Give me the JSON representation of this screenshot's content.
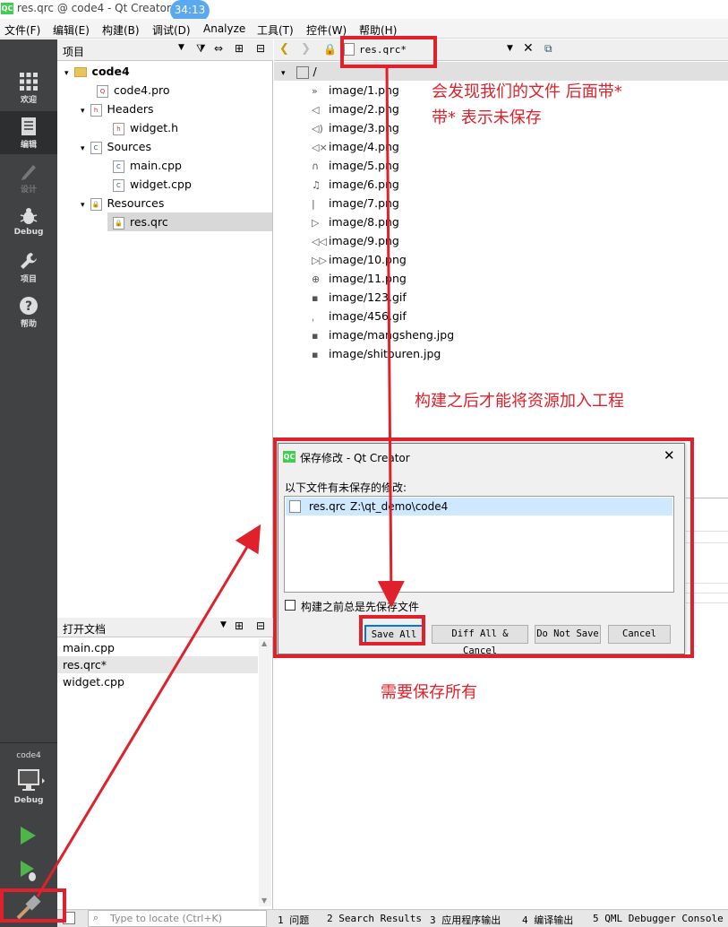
{
  "window": {
    "title": "res.qrc @ code4 - Qt Creator",
    "timer": "34:13"
  },
  "menu": [
    "文件(F)",
    "编辑(E)",
    "构建(B)",
    "调试(D)",
    "Analyze",
    "工具(T)",
    "控件(W)",
    "帮助(H)"
  ],
  "modes": [
    {
      "label": "欢迎",
      "icon": "grid-icon"
    },
    {
      "label": "编辑",
      "icon": "edit-icon"
    },
    {
      "label": "设计",
      "icon": "pen-icon"
    },
    {
      "label": "Debug",
      "icon": "bug-icon"
    },
    {
      "label": "项目",
      "icon": "wrench-icon"
    },
    {
      "label": "帮助",
      "icon": "help-icon"
    }
  ],
  "kit": {
    "project": "code4",
    "mode": "Debug"
  },
  "project_panel": {
    "title": "项目",
    "tree": [
      {
        "label": "code4",
        "level": 0,
        "bold": true
      },
      {
        "label": "code4.pro",
        "level": 1
      },
      {
        "label": "Headers",
        "level": 1
      },
      {
        "label": "widget.h",
        "level": 2
      },
      {
        "label": "Sources",
        "level": 1
      },
      {
        "label": "main.cpp",
        "level": 2
      },
      {
        "label": "widget.cpp",
        "level": 2
      },
      {
        "label": "Resources",
        "level": 1
      },
      {
        "label": "res.qrc",
        "level": 2,
        "selected": true
      }
    ]
  },
  "open_docs": {
    "title": "打开文档",
    "items": [
      "main.cpp",
      "res.qrc*",
      "widget.cpp"
    ]
  },
  "editor": {
    "tab_label": "res.qrc*",
    "prefix": "/",
    "files": [
      "image/1.png",
      "image/2.png",
      "image/3.png",
      "image/4.png",
      "image/5.png",
      "image/6.png",
      "image/7.png",
      "image/8.png",
      "image/9.png",
      "image/10.png",
      "image/11.png",
      "image/123.gif",
      "image/456.gif",
      "image/mangsheng.jpg",
      "image/shitouren.jpg"
    ]
  },
  "dialog": {
    "title": "保存修改 - Qt Creator",
    "prompt": "以下文件有未保存的修改:",
    "file_name": "res.qrc",
    "file_path": "Z:\\qt_demo\\code4",
    "checkbox_label": "构建之前总是先保存文件",
    "buttons": [
      "Save All",
      "Diff All & Cancel",
      "Do Not Save",
      "Cancel"
    ]
  },
  "statusbar": {
    "locate_placeholder": "Type to locate (Ctrl+K)",
    "tabs": [
      "1 问题",
      "2 Search Results",
      "3 应用程序输出",
      "4 编译输出",
      "5 QML Debugger Console"
    ]
  },
  "annotations": [
    "会发现我们的文件 后面带*",
    "带*   表示未保存",
    "构建之后才能将资源加入工程",
    "需要保存所有"
  ],
  "colors": {
    "annotation": "#e0202a",
    "modebar": "#404244",
    "selection": "#cde8ff",
    "qt_green": "#41cd52"
  }
}
